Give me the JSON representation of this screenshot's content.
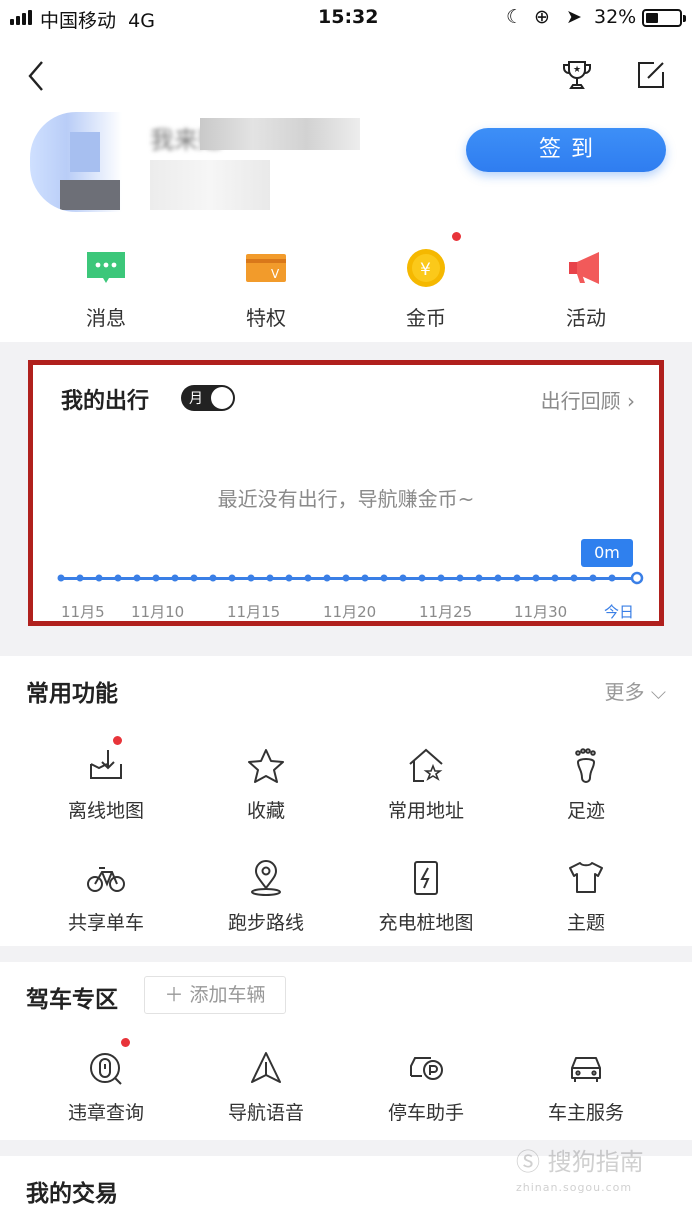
{
  "status_bar": {
    "carrier": "中国移动",
    "network": "4G",
    "time": "15:32",
    "battery": "32%"
  },
  "profile": {
    "name_partial": "我来赚",
    "signin_label": "签到"
  },
  "quick_actions": [
    {
      "label": "消息",
      "icon": "message-icon",
      "color": "#3cc77a"
    },
    {
      "label": "特权",
      "icon": "privilege-card-icon",
      "color": "#f29b2b"
    },
    {
      "label": "金币",
      "icon": "gold-coin-icon",
      "color": "#f5b800"
    },
    {
      "label": "活动",
      "icon": "megaphone-icon",
      "color": "#f25a5a"
    }
  ],
  "travel": {
    "title": "我的出行",
    "toggle_label": "月",
    "review_label": "出行回顾",
    "empty_text": "最近没有出行，导航赚金币~",
    "distance_badge": "0m",
    "dates": [
      "11月5",
      "11月10",
      "11月15",
      "11月20",
      "11月25",
      "11月30",
      "今日"
    ]
  },
  "common": {
    "title": "常用功能",
    "more_label": "更多",
    "items": [
      {
        "label": "离线地图",
        "icon": "offline-map-icon"
      },
      {
        "label": "收藏",
        "icon": "star-icon"
      },
      {
        "label": "常用地址",
        "icon": "home-star-icon"
      },
      {
        "label": "足迹",
        "icon": "footprint-icon"
      },
      {
        "label": "共享单车",
        "icon": "bicycle-icon"
      },
      {
        "label": "跑步路线",
        "icon": "location-pin-icon"
      },
      {
        "label": "充电桩地图",
        "icon": "charging-pile-icon"
      },
      {
        "label": "主题",
        "icon": "tshirt-icon"
      }
    ]
  },
  "driving": {
    "title": "驾车专区",
    "add_vehicle_label": "添加车辆",
    "items": [
      {
        "label": "违章查询",
        "icon": "violation-query-icon"
      },
      {
        "label": "导航语音",
        "icon": "navigation-voice-icon"
      },
      {
        "label": "停车助手",
        "icon": "parking-assistant-icon"
      },
      {
        "label": "车主服务",
        "icon": "car-service-icon"
      }
    ]
  },
  "trades": {
    "title": "我的交易"
  },
  "watermark": {
    "text": "搜狗指南",
    "url": "zhinan.sogou.com"
  }
}
